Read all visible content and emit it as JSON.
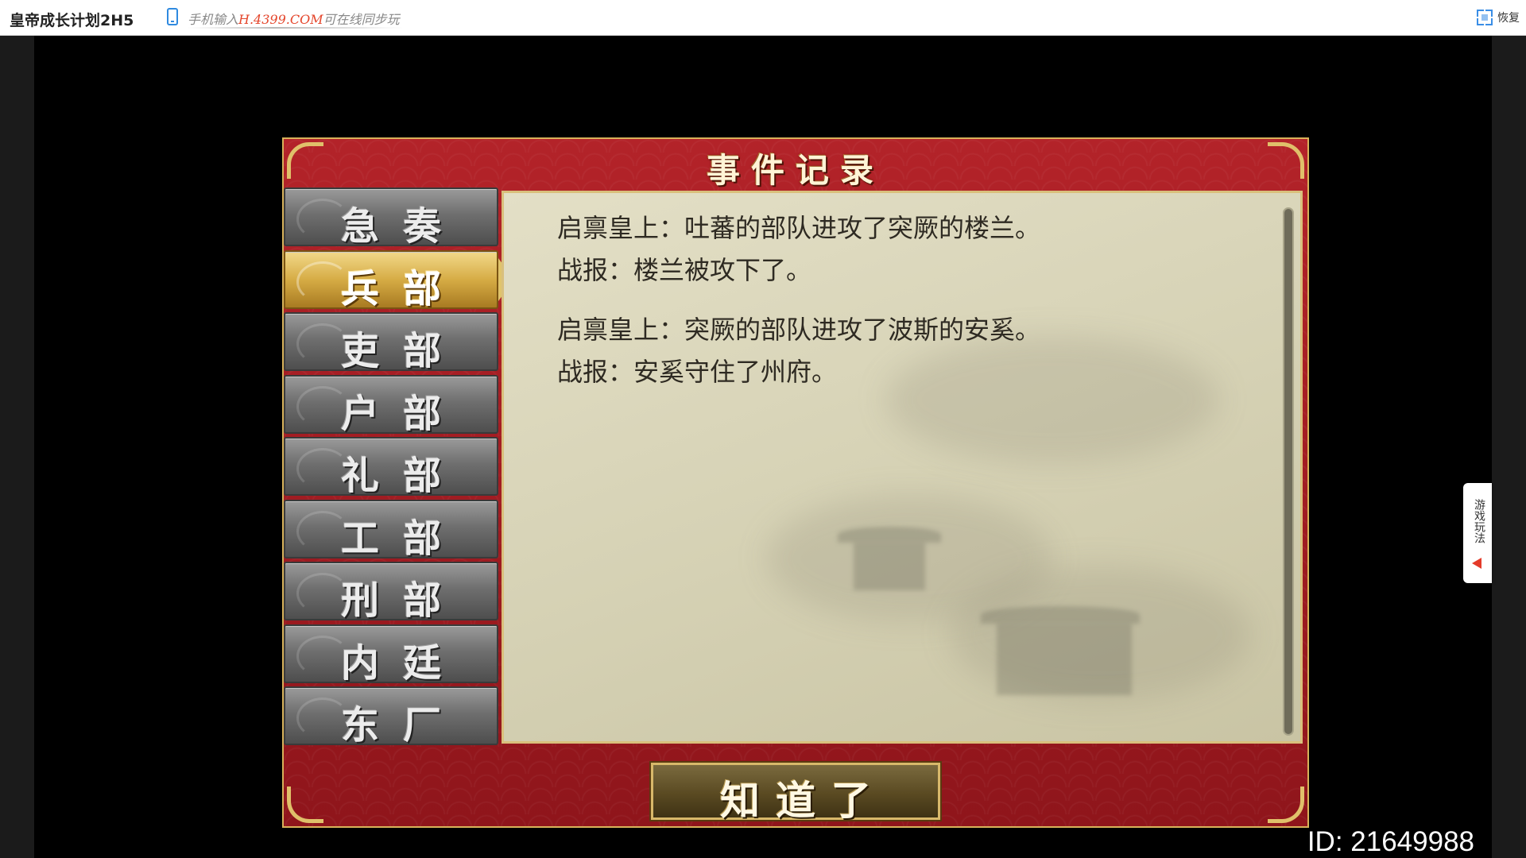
{
  "window": {
    "title": "皇帝成长计划2H5",
    "promo_prefix": "手机输入",
    "promo_url": "H.4399.COM",
    "promo_suffix": "可在线同步玩",
    "restore_label": "恢复"
  },
  "side_tab": {
    "label": "游戏玩法"
  },
  "id_label": "ID: 21649988",
  "dialog": {
    "title": "事件记录",
    "tabs": [
      {
        "label": "急奏",
        "active": false
      },
      {
        "label": "兵部",
        "active": true
      },
      {
        "label": "吏部",
        "active": false
      },
      {
        "label": "户部",
        "active": false
      },
      {
        "label": "礼部",
        "active": false
      },
      {
        "label": "工部",
        "active": false
      },
      {
        "label": "刑部",
        "active": false
      },
      {
        "label": "内廷",
        "active": false
      },
      {
        "label": "东厂",
        "active": false
      }
    ],
    "events": [
      {
        "report": "启禀皇上：吐蕃的部队进攻了突厥的楼兰。",
        "result": "战报：楼兰被攻下了。"
      },
      {
        "report": "启禀皇上：突厥的部队进攻了波斯的安奚。",
        "result": "战报：安奚守住了州府。"
      }
    ],
    "confirm_label": "知道了"
  }
}
